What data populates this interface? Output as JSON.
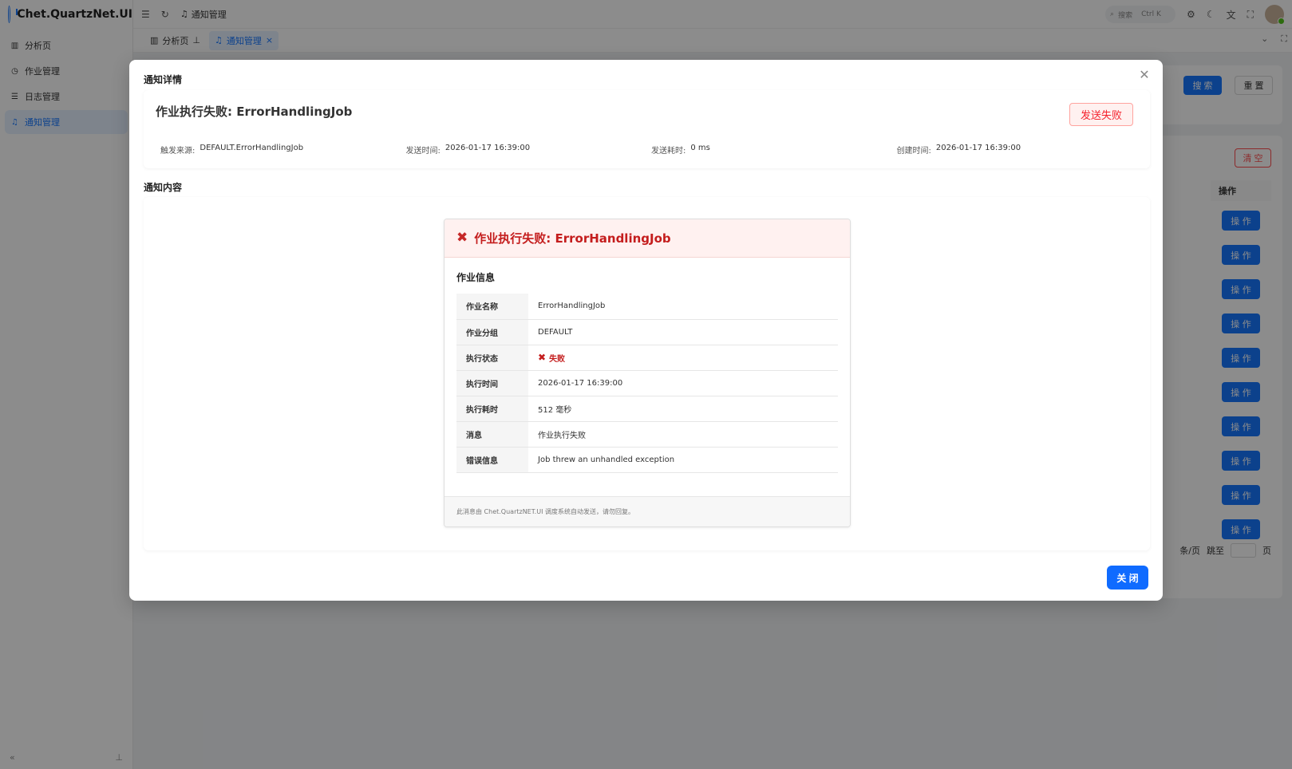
{
  "app": {
    "title": "Chet.QuartzNet.UI"
  },
  "sidebar": {
    "items": [
      {
        "label": "分析页",
        "icon": "chart-icon",
        "active": false
      },
      {
        "label": "作业管理",
        "icon": "clock-icon",
        "active": false
      },
      {
        "label": "日志管理",
        "icon": "list-icon",
        "active": false
      },
      {
        "label": "通知管理",
        "icon": "bell-icon",
        "active": true
      }
    ]
  },
  "header": {
    "breadcrumb": "通知管理",
    "search_placeholder": "搜索",
    "search_shortcut": "Ctrl K"
  },
  "tabs": [
    {
      "label": "分析页",
      "icon": "chart-icon",
      "active": false
    },
    {
      "label": "通知管理",
      "icon": "bell-icon",
      "active": true
    }
  ],
  "background": {
    "search_button": "搜 索",
    "reset_button": "重 置",
    "clear_button": "清 空",
    "operation_header": "操作",
    "operation_button": "操 作",
    "operation_rows": 10,
    "page_size_suffix": "条/页",
    "jump_label": "跳至",
    "page_label": "页"
  },
  "modal": {
    "title": "通知详情",
    "notification_title": "作业执行失败: ErrorHandlingJob",
    "status": "发送失败",
    "meta": [
      {
        "label": "触发来源:",
        "value": "DEFAULT.ErrorHandlingJob"
      },
      {
        "label": "发送时间:",
        "value": "2026-01-17 16:39:00"
      },
      {
        "label": "发送耗时:",
        "value": "0 ms"
      },
      {
        "label": "创建时间:",
        "value": "2026-01-17 16:39:00"
      }
    ],
    "content_label": "通知内容",
    "close_button": "关 闭"
  },
  "email": {
    "header_title": "作业执行失败: ErrorHandlingJob",
    "section_title": "作业信息",
    "rows": [
      {
        "key": "作业名称",
        "value": "ErrorHandlingJob"
      },
      {
        "key": "作业分组",
        "value": "DEFAULT"
      },
      {
        "key": "执行状态",
        "value": "失败"
      },
      {
        "key": "执行时间",
        "value": "2026-01-17 16:39:00"
      },
      {
        "key": "执行耗时",
        "value": "512 毫秒"
      },
      {
        "key": "消息",
        "value": "作业执行失败"
      },
      {
        "key": "错误信息",
        "value": "Job threw an unhandled exception"
      }
    ],
    "footer": "此消息由 Chet.QuartzNET.UI 调度系统自动发送，请勿回复。"
  },
  "colors": {
    "primary": "#1677ff",
    "danger": "#f5222d",
    "error_text": "#c41d1d"
  }
}
